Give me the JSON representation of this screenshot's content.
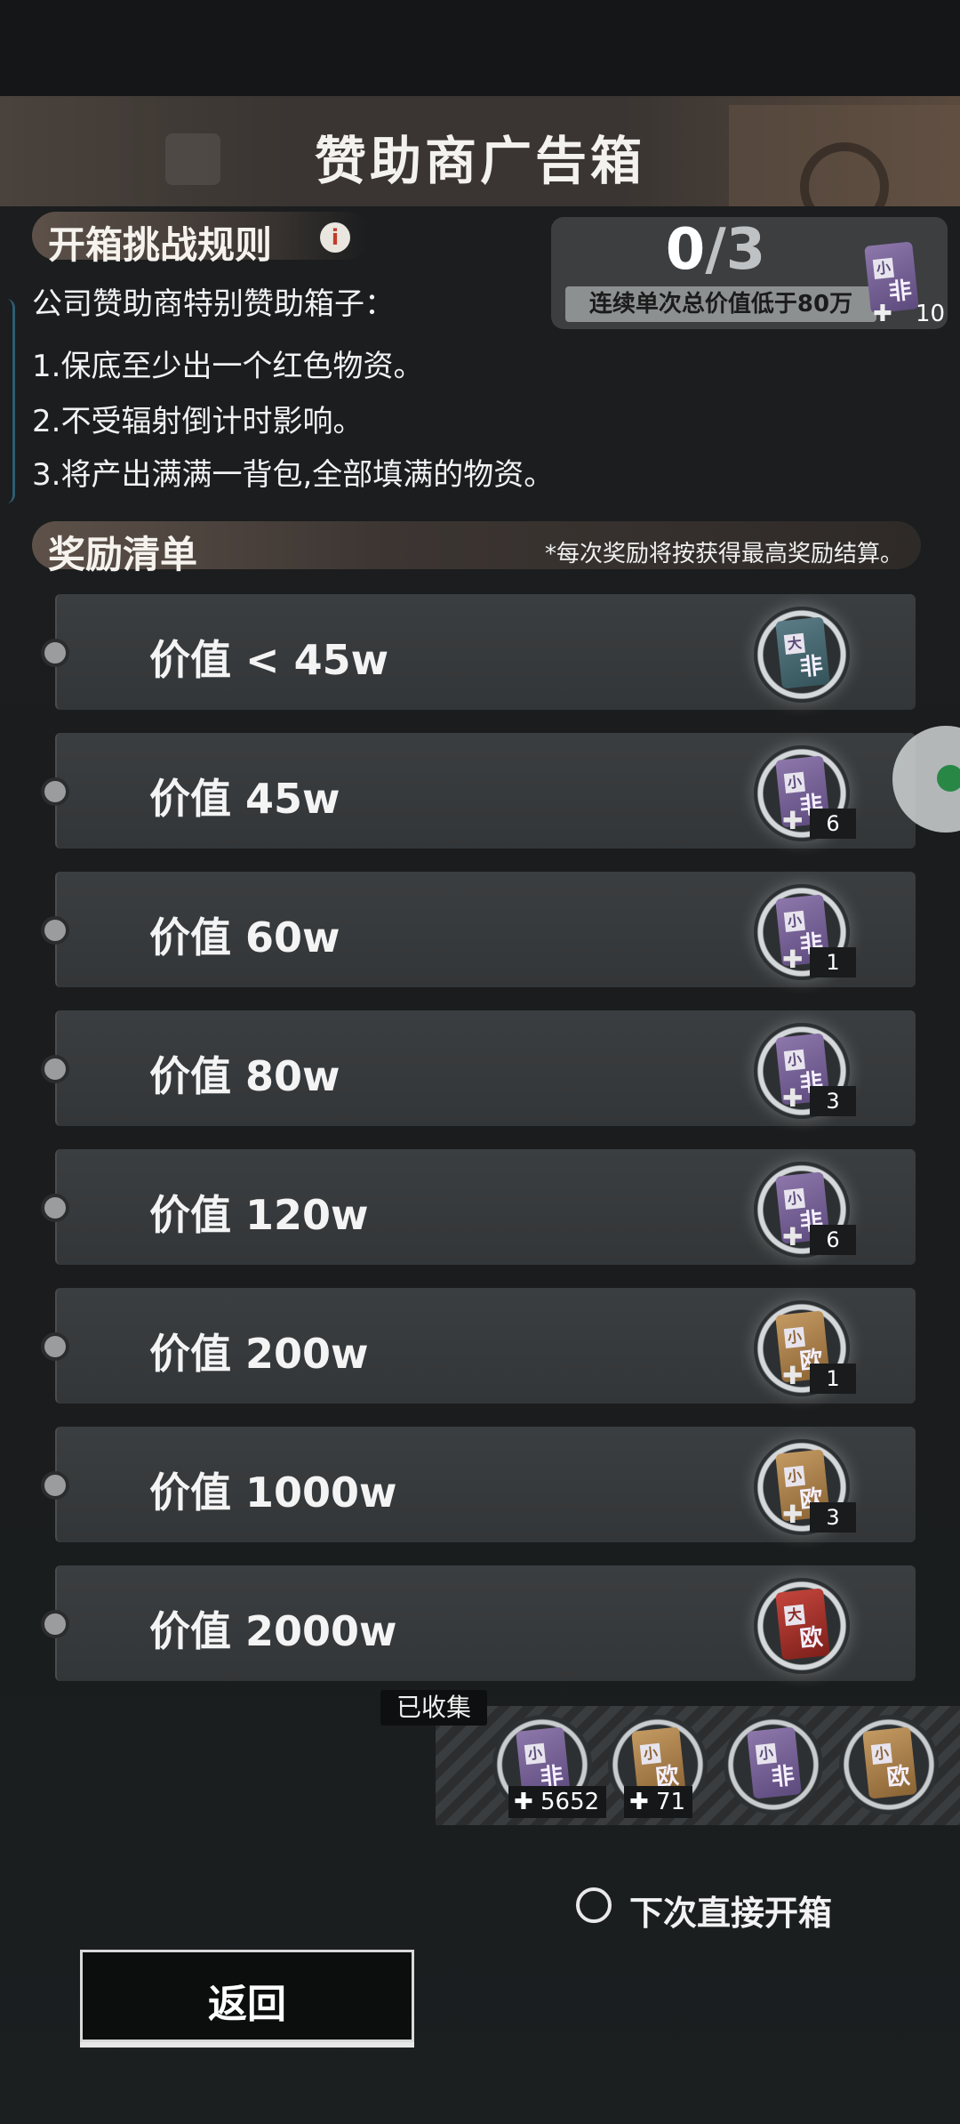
{
  "header": {
    "title": "赞助商广告箱"
  },
  "rules": {
    "title": "开箱挑战规则",
    "info_icon_glyph": "i",
    "lines": [
      "公司赞助商特别赞助箱子：",
      "1.保底至少出一个红色物资。",
      "2.不受辐射倒计时影响。",
      "3.将产出满满一背包,全部填满的物资。"
    ]
  },
  "progress": {
    "current": "0",
    "total": "/3",
    "caption": "连续单次总价值低于80万",
    "reward_qty": "10"
  },
  "rewards": {
    "title": "奖励清单",
    "note": "*每次奖励将按获得最高奖励结算。",
    "items": [
      {
        "label": "价值 < 45w",
        "ticket": "大",
        "ticket_big": "非",
        "color": "teal",
        "qty": ""
      },
      {
        "label": "价值 45w",
        "ticket": "小",
        "ticket_big": "非",
        "color": "purple",
        "qty": "6"
      },
      {
        "label": "价值 60w",
        "ticket": "小",
        "ticket_big": "非",
        "color": "purple",
        "qty": "1"
      },
      {
        "label": "价值 80w",
        "ticket": "小",
        "ticket_big": "非",
        "color": "purple",
        "qty": "3"
      },
      {
        "label": "价值 120w",
        "ticket": "小",
        "ticket_big": "非",
        "color": "purple",
        "qty": "6"
      },
      {
        "label": "价值 200w",
        "ticket": "小",
        "ticket_big": "欧",
        "color": "gold",
        "qty": "1"
      },
      {
        "label": "价值 1000w",
        "ticket": "小",
        "ticket_big": "欧",
        "color": "gold",
        "qty": "3"
      },
      {
        "label": "价值 2000w",
        "ticket": "大",
        "ticket_big": "欧",
        "color": "red",
        "qty": ""
      }
    ]
  },
  "collected": {
    "label": "已收集",
    "items": [
      {
        "ticket": "小",
        "ticket_big": "非",
        "color": "purple",
        "count": "5652"
      },
      {
        "ticket": "小",
        "ticket_big": "欧",
        "color": "gold",
        "count": "71"
      },
      {
        "ticket": "小",
        "ticket_big": "非",
        "color": "purple",
        "count": ""
      },
      {
        "ticket": "小",
        "ticket_big": "欧",
        "color": "gold",
        "count": ""
      }
    ]
  },
  "auto_open": {
    "label": "下次直接开箱",
    "checked": false
  },
  "back_button": {
    "label": "返回"
  },
  "icons": {
    "puzzle": "puzzle-piece-icon",
    "info": "info-icon",
    "radio": "radio-unchecked-icon"
  }
}
